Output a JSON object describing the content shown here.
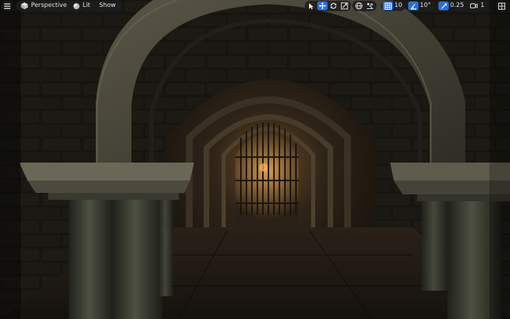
{
  "viewport_toolbar": {
    "view_mode_label": "Perspective",
    "lighting_mode_label": "Lit",
    "show_label": "Show",
    "grid_snap_value": "10",
    "rotation_snap_value": "10°",
    "scale_snap_value": "0.25",
    "camera_speed_value": "1"
  },
  "colors": {
    "toolbar_background": "#1c1c1e",
    "active_toggle": "#2a6fd6",
    "toolbar_text": "#e6e6e6"
  }
}
